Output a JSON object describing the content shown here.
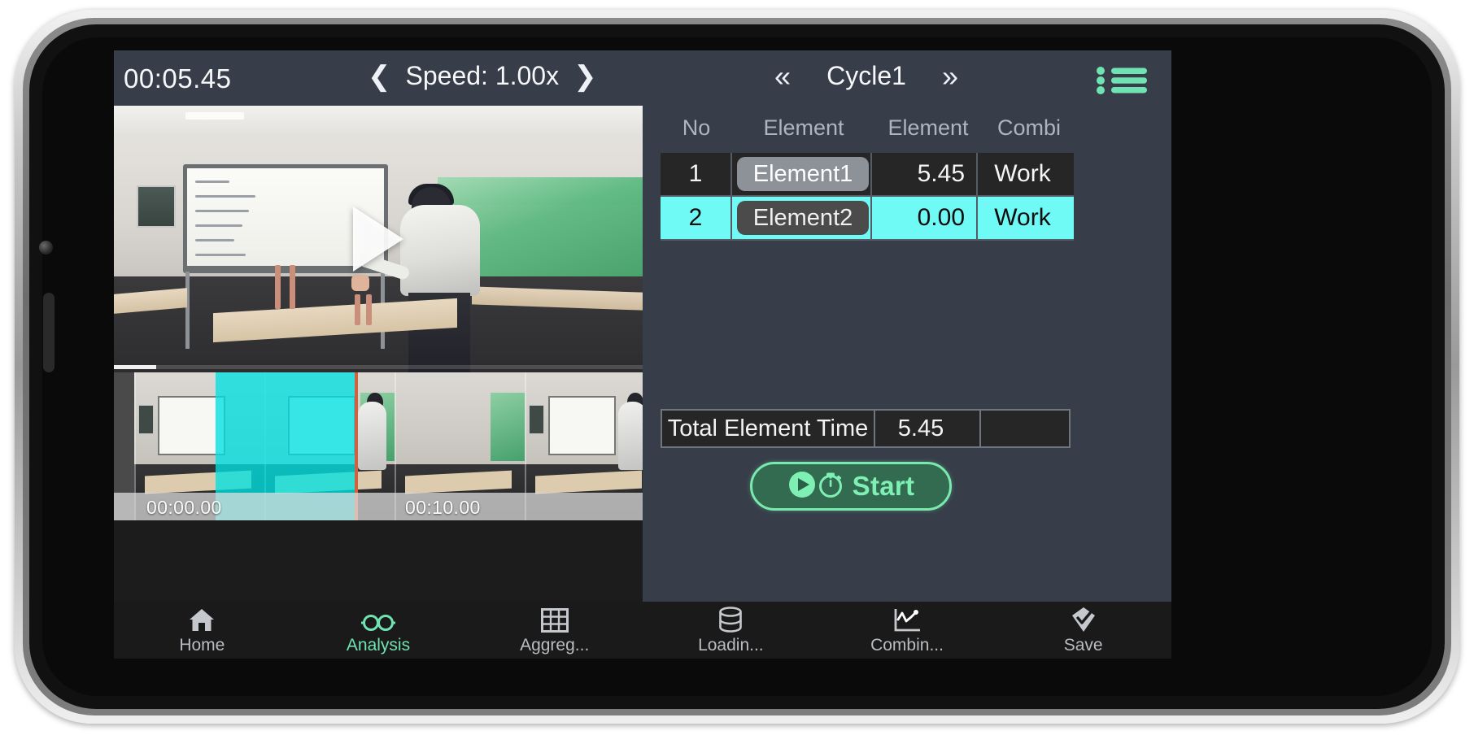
{
  "app": {
    "accent_green": "#6fe3b2",
    "accent_cyan": "#6ffaf5",
    "panel_bg": "#373e49",
    "row_dark_bg": "#262626",
    "playhead_color": "#d2603f"
  },
  "topbar": {
    "clock": "00:05.45",
    "speed_prev_icon": "chevron-left",
    "speed_label": "Speed: 1.00x",
    "speed_next_icon": "chevron-right",
    "cycle_prev_icon": "double-chevron-left",
    "cycle_label": "Cycle1",
    "cycle_next_icon": "double-chevron-right",
    "menu_icon": "list-bullets-icon"
  },
  "video": {
    "play_icon": "play-triangle-icon",
    "progress_percent": 8
  },
  "filmstrip": {
    "start_time_label": "00:00.00",
    "end_time_label": "00:10.00",
    "selection_color": "#00e0e0",
    "playhead_color": "#d2603f"
  },
  "table": {
    "headers": [
      "No",
      "Element",
      "Element",
      "Combi"
    ],
    "rows": [
      {
        "no": "1",
        "element": "Element1",
        "time": "5.45",
        "combi": "Work",
        "selected": false
      },
      {
        "no": "2",
        "element": "Element2",
        "time": "0.00",
        "combi": "Work",
        "selected": true
      }
    ],
    "total": {
      "label": "Total Element Time",
      "value": "5.45",
      "extra": ""
    }
  },
  "start_button": {
    "label": "Start",
    "play_icon": "play-circle-icon",
    "timer_icon": "stopwatch-icon"
  },
  "bottom_nav": {
    "items": [
      {
        "label": "Home",
        "icon": "home-icon",
        "active": false
      },
      {
        "label": "Analysis",
        "icon": "glasses-icon",
        "active": true
      },
      {
        "label": "Aggreg...",
        "icon": "grid-icon",
        "active": false
      },
      {
        "label": "Loadin...",
        "icon": "database-icon",
        "active": false
      },
      {
        "label": "Combin...",
        "icon": "line-chart-icon",
        "active": false
      },
      {
        "label": "Save",
        "icon": "check-diamond-icon",
        "active": false
      }
    ]
  }
}
